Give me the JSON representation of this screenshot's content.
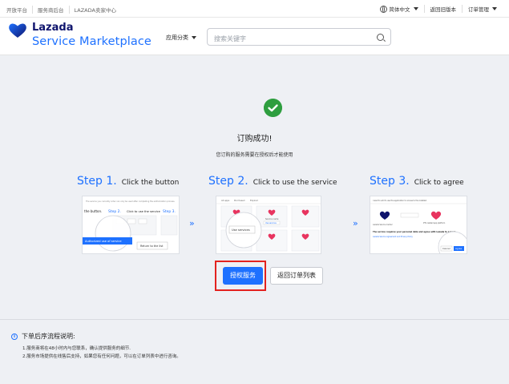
{
  "topbar": {
    "links": [
      "开放平台",
      "服务商后台",
      "LAZADA卖家中心"
    ],
    "language": "简体中文",
    "old_version": "返回旧版本",
    "order_mgmt": "订单管理"
  },
  "header": {
    "logo_line1": "Lazada",
    "logo_line2": "Service Marketplace",
    "category": "应用分类",
    "search_placeholder": "搜索关键字"
  },
  "success": {
    "title": "订购成功!",
    "subtitle": "您订购的服务需要在授权后才能使用"
  },
  "steps": [
    {
      "num": "Step 1.",
      "text": "Click the button"
    },
    {
      "num": "Step 2.",
      "text": "Click to use the service"
    },
    {
      "num": "Step 3.",
      "text": "Click to agree"
    }
  ],
  "shot1": {
    "line": "The service you currently order can only be used after completing the authorization process.",
    "label_a": "the button.",
    "label_b": "Step 2.",
    "label_c": "Click to use the service",
    "label_d": "Step 3.",
    "btn_auth": "Authorized use of service",
    "btn_return": "Return to the list"
  },
  "shot2": {
    "tabs": [
      "All apps",
      "Purchased",
      "Expired"
    ],
    "lens_label": "Use services",
    "card_label": "Service name",
    "card_btn": "Use services"
  },
  "shot3": {
    "top_line": "I want to add to use the application to access to the installed.",
    "left_caption": "Lazada Service Center",
    "right_caption": "PTS related app platform",
    "bold_line": "The service requires your personal data and agree with Lazada to Lazada",
    "link_line": "Lazada Service Agreement and Privacy Policy",
    "cancel": "Cancel",
    "agree": "Agree"
  },
  "actions": {
    "authorize": "授权服务",
    "back": "返回订单列表"
  },
  "notes": {
    "title": "下单后序流程说明:",
    "items": [
      "1.服务商将在48小时内与您联系，确认提供服务的细节.",
      "2.服务市场提供在线售后支持，如果您有任何问题，可以在订单列表中进行咨询。"
    ]
  },
  "colors": {
    "accent": "#1e71ff",
    "success": "#2e9e3f",
    "highlight": "#e3221f",
    "brand_dark": "#0f146d"
  }
}
